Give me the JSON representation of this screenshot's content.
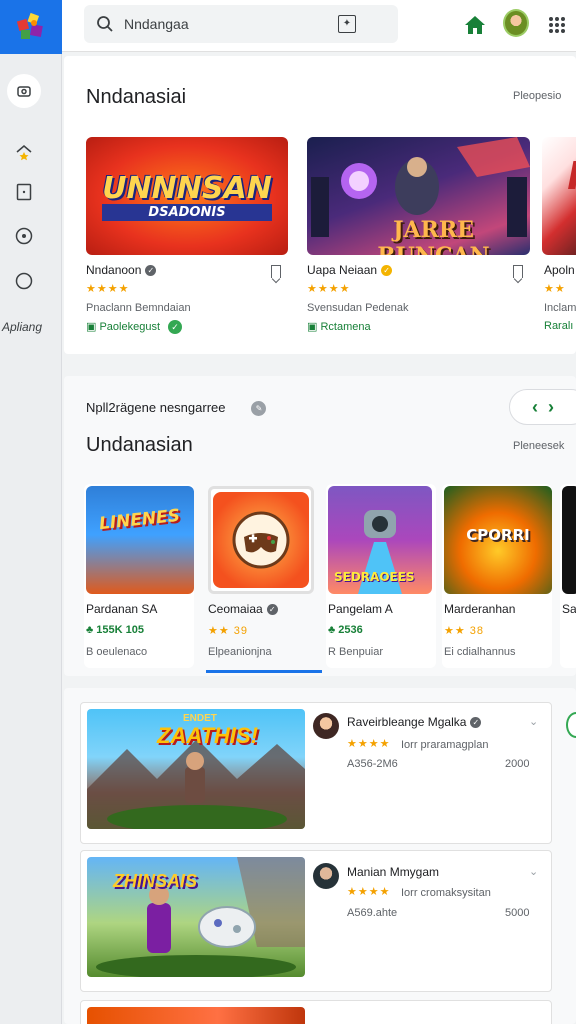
{
  "search": {
    "value": "Nndangaa"
  },
  "sidebar": {
    "label": "Apliang"
  },
  "featured": {
    "title": "Nndanasiai",
    "link": "Pleopesio",
    "games": [
      {
        "art_title": "UNNNSAN",
        "art_subtitle": "DSADONIS",
        "name": "Nndanoon",
        "stars": "★★★★",
        "developer": "Pnaclann Bemndaian",
        "tag": "Paolekegust"
      },
      {
        "art_title": "JARRE RUNCAN",
        "name": "Uapa Neiaan",
        "stars": "★★★★",
        "developer": "Svensudan Pedenak",
        "tag": "Rctamena"
      },
      {
        "art_title": "K",
        "name": "Apoln",
        "stars": "★★",
        "developer": "Inclam",
        "tag": "Raralı"
      }
    ]
  },
  "secondary": {
    "subtitle": "Npll2rägene nesngarree",
    "title": "Undanasian",
    "link": "Pleneesek",
    "tiles": [
      {
        "art_title": "LINENES",
        "name": "Pardanan SA",
        "rating": "155K 105",
        "caption": "B oeulenaco"
      },
      {
        "art_title": "",
        "name": "Ceomaiaa",
        "rating": "39",
        "caption": "Elpeanionjna"
      },
      {
        "art_title": "SEDRAOEES",
        "name": "Pangelam A",
        "rating": "2536",
        "caption": "R Benpuiar"
      },
      {
        "art_title": "CPORRI",
        "name": "Marderanhan",
        "rating": "38",
        "caption": "Ei cdialhannus"
      },
      {
        "art_title": "",
        "name": "Sa",
        "rating": "",
        "caption": ""
      }
    ]
  },
  "list": [
    {
      "art_title": "ZAATHIS!",
      "art_small": "ENDET",
      "title": "Raveirbleange Mgalka",
      "stars": "★★★★",
      "sub": "Iorr praramagplan",
      "code": "A356-2M6",
      "value": "2000"
    },
    {
      "art_title": "ZHINSAIS",
      "title": "Manian Mmygam",
      "stars": "★★★★",
      "sub": "Iorr cromaksysitan",
      "code": "A569.ahte",
      "value": "5000"
    }
  ],
  "colors": {
    "accent": "#1a73e8",
    "green": "#188038",
    "star": "#f4a100"
  },
  "icons": [
    "search-icon",
    "filter-icon",
    "home-icon",
    "apps-grid-icon",
    "verified-icon",
    "bookmark-icon"
  ]
}
